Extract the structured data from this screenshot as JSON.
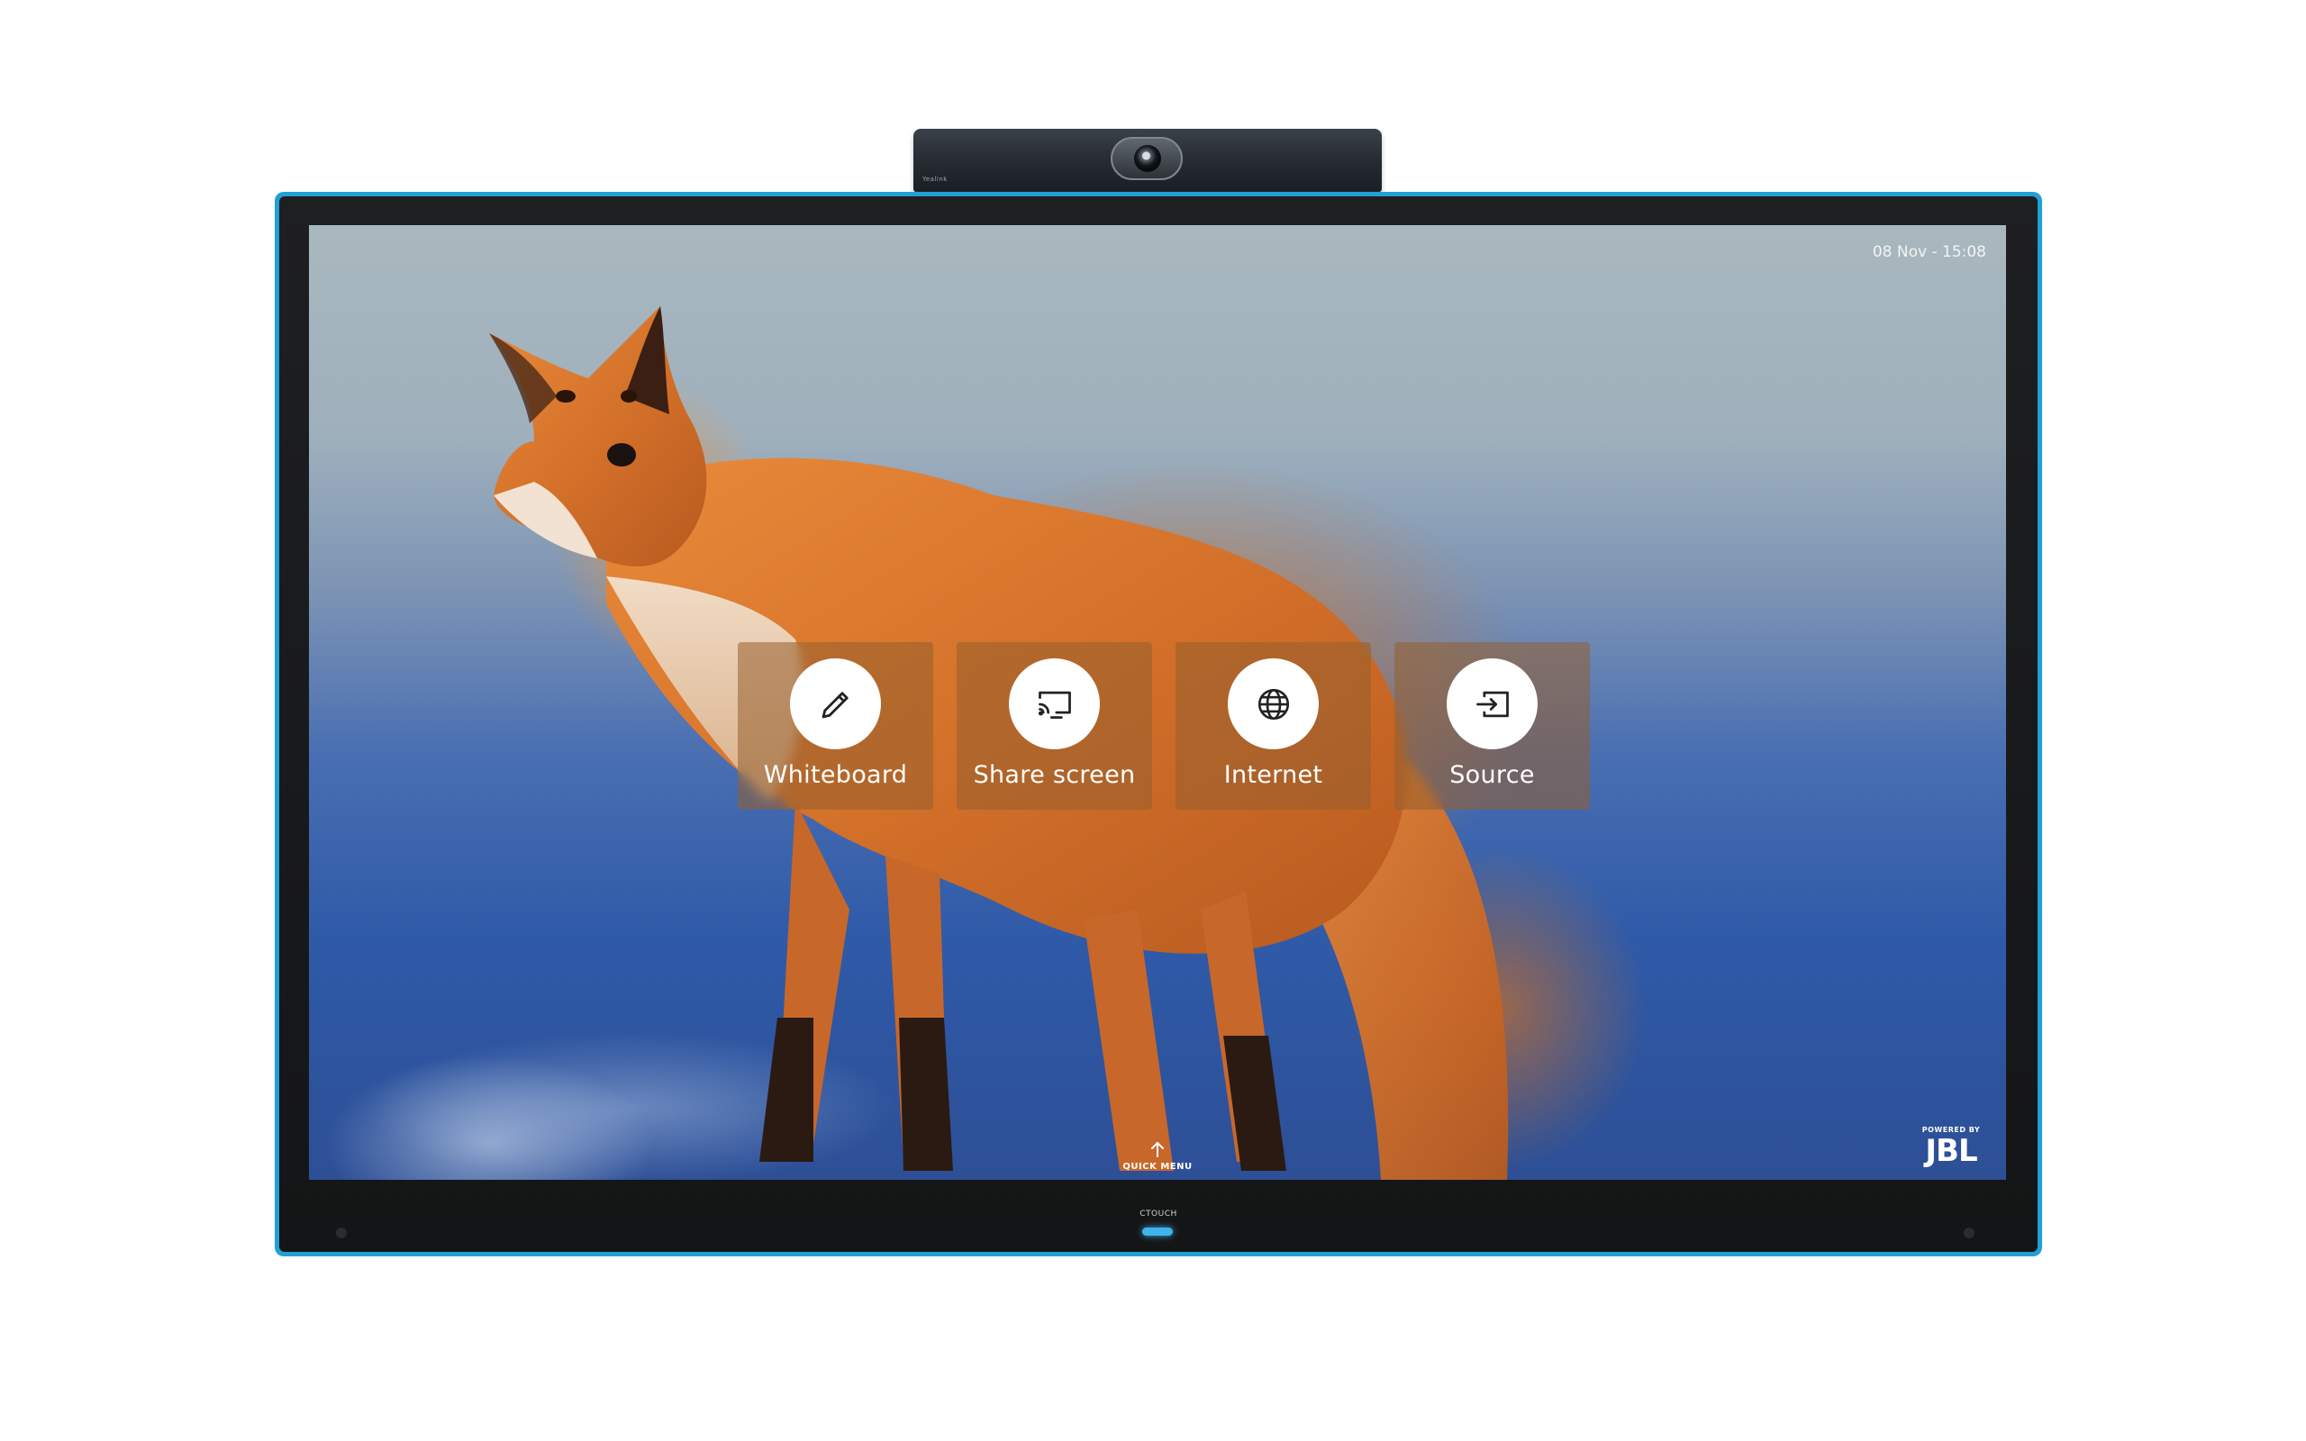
{
  "camera": {
    "brand": "Yealink"
  },
  "status_bar": {
    "datetime": "08 Nov - 15:08"
  },
  "tiles": [
    {
      "label": "Whiteboard",
      "icon": "pencil-icon"
    },
    {
      "label": "Share screen",
      "icon": "cast-screen-icon"
    },
    {
      "label": "Internet",
      "icon": "globe-icon"
    },
    {
      "label": "Source",
      "icon": "input-source-icon"
    }
  ],
  "quick_menu": {
    "label": "QUICK MENU",
    "icon": "arrow-up-icon"
  },
  "jbl": {
    "powered_by": "POWERED BY",
    "logo": "JBL"
  },
  "monitor": {
    "brand": "CTOUCH"
  },
  "colors": {
    "frame_accent": "#1fa1d6",
    "power_led": "#3fb4ec",
    "tile_bg": "rgba(150,95,45,0.55)"
  }
}
